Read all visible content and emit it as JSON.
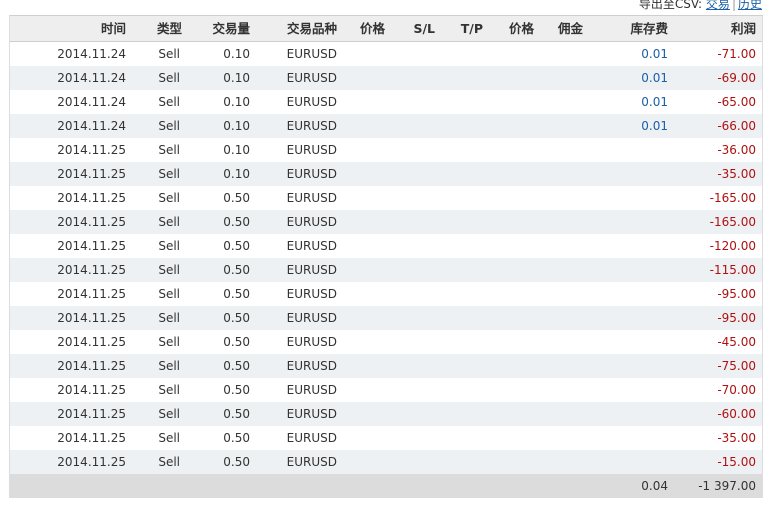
{
  "export": {
    "prefix": "导出至CSV: ",
    "link_trades": "交易",
    "separator": "|",
    "link_history": "历史"
  },
  "headers": [
    "时间",
    "类型",
    "交易量",
    "交易品种",
    "价格",
    "S/L",
    "T/P",
    "价格",
    "佣金",
    "库存费",
    "利润"
  ],
  "rows": [
    {
      "time": "2014.11.24",
      "type": "Sell",
      "volume": "0.10",
      "symbol": "EURUSD",
      "price": "",
      "sl": "",
      "tp": "",
      "price2": "",
      "commission": "",
      "swap": "0.01",
      "profit": "-71.00"
    },
    {
      "time": "2014.11.24",
      "type": "Sell",
      "volume": "0.10",
      "symbol": "EURUSD",
      "price": "",
      "sl": "",
      "tp": "",
      "price2": "",
      "commission": "",
      "swap": "0.01",
      "profit": "-69.00"
    },
    {
      "time": "2014.11.24",
      "type": "Sell",
      "volume": "0.10",
      "symbol": "EURUSD",
      "price": "",
      "sl": "",
      "tp": "",
      "price2": "",
      "commission": "",
      "swap": "0.01",
      "profit": "-65.00"
    },
    {
      "time": "2014.11.24",
      "type": "Sell",
      "volume": "0.10",
      "symbol": "EURUSD",
      "price": "",
      "sl": "",
      "tp": "",
      "price2": "",
      "commission": "",
      "swap": "0.01",
      "profit": "-66.00"
    },
    {
      "time": "2014.11.25",
      "type": "Sell",
      "volume": "0.10",
      "symbol": "EURUSD",
      "price": "",
      "sl": "",
      "tp": "",
      "price2": "",
      "commission": "",
      "swap": "",
      "profit": "-36.00"
    },
    {
      "time": "2014.11.25",
      "type": "Sell",
      "volume": "0.10",
      "symbol": "EURUSD",
      "price": "",
      "sl": "",
      "tp": "",
      "price2": "",
      "commission": "",
      "swap": "",
      "profit": "-35.00"
    },
    {
      "time": "2014.11.25",
      "type": "Sell",
      "volume": "0.50",
      "symbol": "EURUSD",
      "price": "",
      "sl": "",
      "tp": "",
      "price2": "",
      "commission": "",
      "swap": "",
      "profit": "-165.00"
    },
    {
      "time": "2014.11.25",
      "type": "Sell",
      "volume": "0.50",
      "symbol": "EURUSD",
      "price": "",
      "sl": "",
      "tp": "",
      "price2": "",
      "commission": "",
      "swap": "",
      "profit": "-165.00"
    },
    {
      "time": "2014.11.25",
      "type": "Sell",
      "volume": "0.50",
      "symbol": "EURUSD",
      "price": "",
      "sl": "",
      "tp": "",
      "price2": "",
      "commission": "",
      "swap": "",
      "profit": "-120.00"
    },
    {
      "time": "2014.11.25",
      "type": "Sell",
      "volume": "0.50",
      "symbol": "EURUSD",
      "price": "",
      "sl": "",
      "tp": "",
      "price2": "",
      "commission": "",
      "swap": "",
      "profit": "-115.00"
    },
    {
      "time": "2014.11.25",
      "type": "Sell",
      "volume": "0.50",
      "symbol": "EURUSD",
      "price": "",
      "sl": "",
      "tp": "",
      "price2": "",
      "commission": "",
      "swap": "",
      "profit": "-95.00"
    },
    {
      "time": "2014.11.25",
      "type": "Sell",
      "volume": "0.50",
      "symbol": "EURUSD",
      "price": "",
      "sl": "",
      "tp": "",
      "price2": "",
      "commission": "",
      "swap": "",
      "profit": "-95.00"
    },
    {
      "time": "2014.11.25",
      "type": "Sell",
      "volume": "0.50",
      "symbol": "EURUSD",
      "price": "",
      "sl": "",
      "tp": "",
      "price2": "",
      "commission": "",
      "swap": "",
      "profit": "-45.00"
    },
    {
      "time": "2014.11.25",
      "type": "Sell",
      "volume": "0.50",
      "symbol": "EURUSD",
      "price": "",
      "sl": "",
      "tp": "",
      "price2": "",
      "commission": "",
      "swap": "",
      "profit": "-75.00"
    },
    {
      "time": "2014.11.25",
      "type": "Sell",
      "volume": "0.50",
      "symbol": "EURUSD",
      "price": "",
      "sl": "",
      "tp": "",
      "price2": "",
      "commission": "",
      "swap": "",
      "profit": "-70.00"
    },
    {
      "time": "2014.11.25",
      "type": "Sell",
      "volume": "0.50",
      "symbol": "EURUSD",
      "price": "",
      "sl": "",
      "tp": "",
      "price2": "",
      "commission": "",
      "swap": "",
      "profit": "-60.00"
    },
    {
      "time": "2014.11.25",
      "type": "Sell",
      "volume": "0.50",
      "symbol": "EURUSD",
      "price": "",
      "sl": "",
      "tp": "",
      "price2": "",
      "commission": "",
      "swap": "",
      "profit": "-35.00"
    },
    {
      "time": "2014.11.25",
      "type": "Sell",
      "volume": "0.50",
      "symbol": "EURUSD",
      "price": "",
      "sl": "",
      "tp": "",
      "price2": "",
      "commission": "",
      "swap": "",
      "profit": "-15.00"
    }
  ],
  "totals": {
    "swap": "0.04",
    "profit": "-1 397.00"
  },
  "colors": {
    "swap": "#1a5fa8",
    "profit": "#b01010",
    "header_bg": "#eeeeee",
    "alt_row_bg": "#eef1f4",
    "footer_bg": "#dcdcdc"
  }
}
